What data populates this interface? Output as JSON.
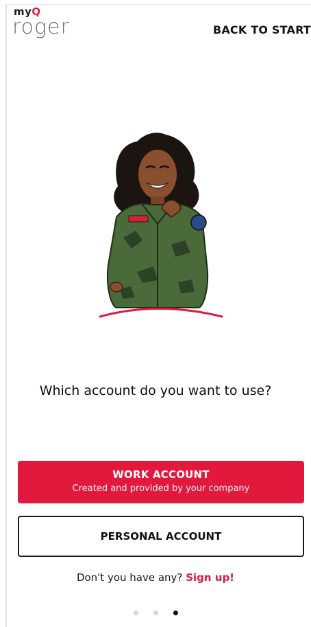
{
  "brand": {
    "top_word": "my",
    "top_letter": "Q",
    "name": "roger",
    "accent_color": "#e3183d"
  },
  "header": {
    "back_label": "BACK TO START"
  },
  "main": {
    "question": "Which account do you want to use?",
    "work_button": {
      "title": "WORK ACCOUNT",
      "subtitle": "Created and provided by your company"
    },
    "personal_button": {
      "title": "PERSONAL ACCOUNT"
    },
    "signup": {
      "prompt": "Don't you have any?",
      "link": "Sign up!"
    }
  },
  "pager": {
    "pages": 3,
    "current": 3
  }
}
